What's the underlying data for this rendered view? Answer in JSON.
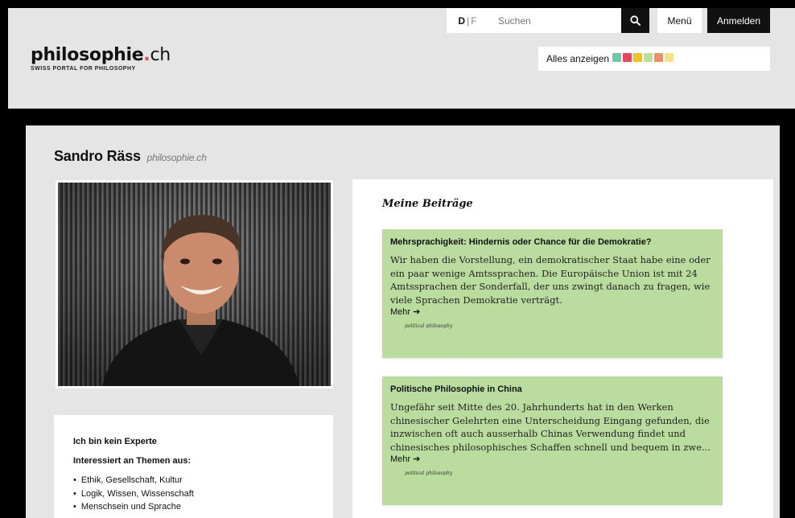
{
  "logo": {
    "main_bold": "philosophie",
    "dot": ".",
    "main_light": "ch",
    "subtitle": "SWISS PORTAL FOR PHILOSOPHY"
  },
  "header": {
    "lang_active": "D",
    "lang_sep": "|",
    "lang_inactive": "F",
    "search_placeholder": "Suchen",
    "menu_label": "Menü",
    "login_label": "Anmelden",
    "filter_label": "Alles anzeigen",
    "filter_colors": [
      "#6cc9a8",
      "#e8455e",
      "#f2c31f",
      "#bcdca0",
      "#ee8d61",
      "#f4e38a"
    ]
  },
  "profile": {
    "name": "Sandro Räss",
    "org": "philosophie.ch",
    "expert": "Ich bin kein Experte",
    "interests_title": "Interessiert an Themen aus:",
    "topics": [
      "Ethik, Gesellschaft, Kultur",
      "Logik, Wissen, Wissenschaft",
      "Menschsein und Sprache"
    ]
  },
  "posts": {
    "title": "Meine Beiträge",
    "items": [
      {
        "title": "Mehrsprachigkeit: Hindernis oder Chance für die Demokratie?",
        "body": "Wir haben die Vorstellung, ein demokratischer Staat habe eine oder ein paar wenige Amtssprachen. Die Europäische Union ist mit 24 Amtssprachen der Sonderfall, der uns zwingt danach zu fragen, wie viele Sprachen Demokratie verträgt.",
        "more": "Mehr ➔",
        "tag": "political philosophy"
      },
      {
        "title": "Politische Philosophie in China",
        "body": "Ungefähr seit Mitte des 20. Jahrhunderts hat in den Werken chinesischer Gelehrten eine Unterscheidung Eingang gefunden, die inzwischen oft auch ausserhalb Chinas Verwendung findet und chinesisches philosophisches Schaffen schnell und bequem in zwe...",
        "more": "Mehr ➔",
        "tag": "political philosophy"
      }
    ]
  }
}
